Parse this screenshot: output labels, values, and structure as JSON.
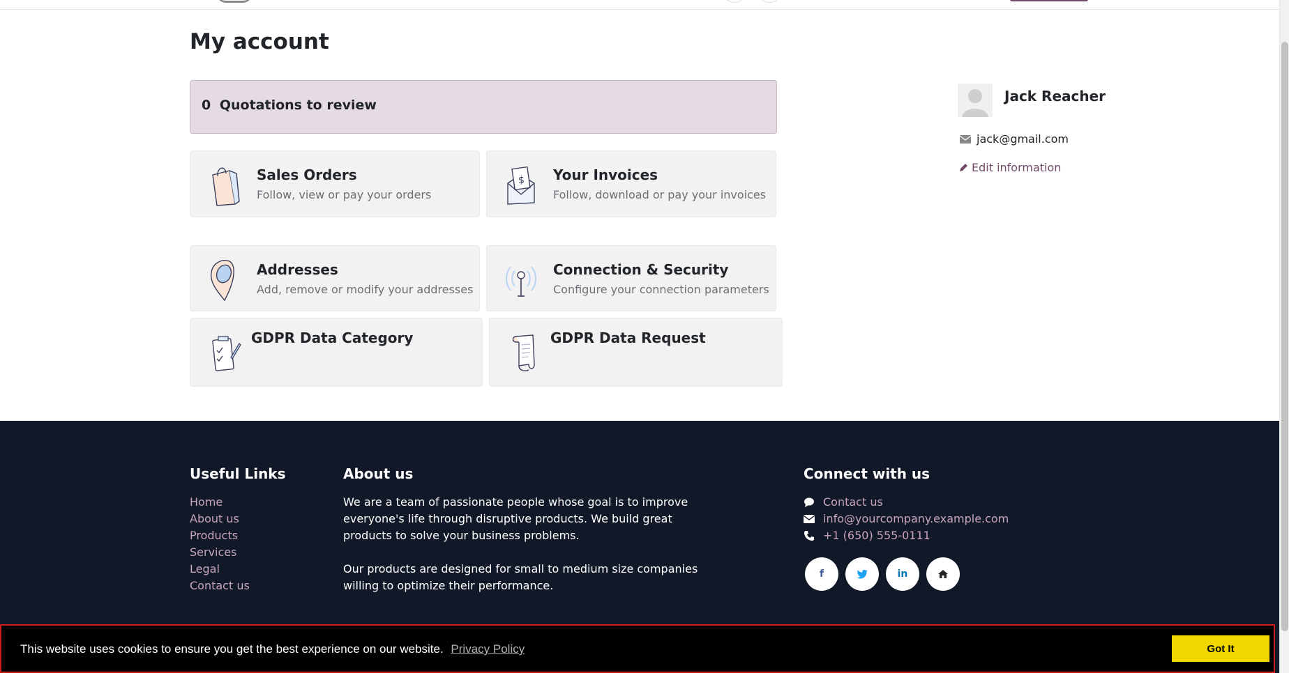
{
  "page": {
    "title": "My account"
  },
  "quotations": {
    "count": "0",
    "label": "Quotations to review"
  },
  "cards": [
    {
      "title": "Sales Orders",
      "subtitle": "Follow, view or pay your orders",
      "icon": "shopping-bag-icon"
    },
    {
      "title": "Your Invoices",
      "subtitle": "Follow, download or pay your invoices",
      "icon": "invoice-envelope-icon"
    },
    {
      "title": "Addresses",
      "subtitle": "Add, remove or modify your addresses",
      "icon": "map-pin-icon"
    },
    {
      "title": "Connection & Security",
      "subtitle": "Configure your connection parameters",
      "icon": "antenna-icon"
    },
    {
      "title": "GDPR Data Category",
      "icon": "clipboard-check-icon"
    },
    {
      "title": "GDPR Data Request",
      "icon": "scroll-document-icon"
    }
  ],
  "user": {
    "name": "Jack Reacher",
    "email": "jack@gmail.com",
    "edit_label": "Edit information"
  },
  "footer": {
    "useful_links_title": "Useful Links",
    "useful_links": [
      "Home",
      "About us",
      "Products",
      "Services",
      "Legal",
      "Contact us"
    ],
    "about_title": "About us",
    "about_p1": "We are a team of passionate people whose goal is to improve everyone's life through disruptive products. We build great products to solve your business problems.",
    "about_p2": "Our products are designed for small to medium size companies willing to optimize their performance.",
    "connect_title": "Connect with us",
    "contact_label": "Contact us",
    "email": "info@yourcompany.example.com",
    "phone": "+1 (650) 555-0111",
    "socials": {
      "facebook": "f",
      "twitter": "twitter-icon",
      "linkedin": "in",
      "home": "home-icon"
    }
  },
  "cookie": {
    "message": "This website uses cookies to ensure you get the best experience on our website.",
    "policy_label": "Privacy Policy",
    "accept_label": "Got It"
  },
  "colors": {
    "brand": "#714b67",
    "footer_bg": "#111827",
    "cookie_button": "#f1d600",
    "alert_bg": "#e5dbe3"
  }
}
